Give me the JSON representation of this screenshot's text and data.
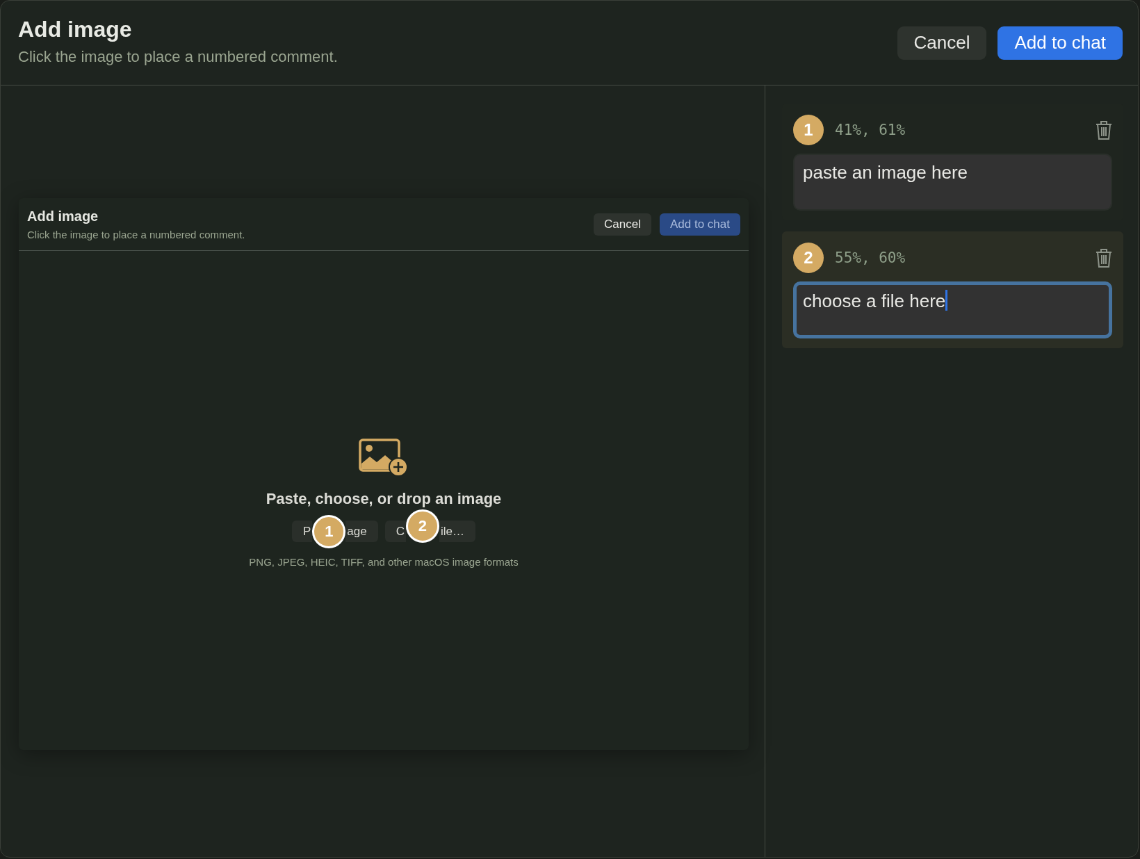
{
  "header": {
    "title": "Add image",
    "subtitle": "Click the image to place a numbered comment."
  },
  "buttons": [
    {
      "label": "Cancel",
      "kind": "secondary"
    },
    {
      "label": "Add to chat",
      "kind": "primary"
    }
  ],
  "preview": {
    "title": "Add image",
    "subtitle": "Click the image to place a numbered comment.",
    "buttons": [
      {
        "label": "Cancel",
        "kind": "secondary"
      },
      {
        "label": "Add to chat",
        "kind": "muted"
      }
    ],
    "heading": "Paste, choose, or drop an image",
    "actions": [
      {
        "label_start": "P",
        "label_end": "age",
        "pin": "1"
      },
      {
        "label_start": "C",
        "label_end": "ile…",
        "pin": "2"
      }
    ],
    "formats": "PNG, JPEG, HEIC, TIFF, and other macOS image formats"
  },
  "comments": [
    {
      "number": "1",
      "position": "41%, 61%",
      "text": "paste an image here",
      "selected": false
    },
    {
      "number": "2",
      "position": "55%, 60%",
      "text": "choose a file here",
      "selected": true
    }
  ]
}
